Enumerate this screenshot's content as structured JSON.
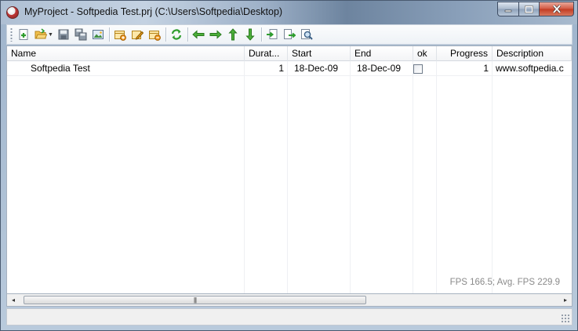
{
  "window": {
    "title": "MyProject - Softpedia Test.prj (C:\\Users\\Softpedia\\Desktop)",
    "minimize_icon": "minimize-icon",
    "maximize_icon": "maximize-icon",
    "close_icon": "close-icon"
  },
  "toolbar": {
    "buttons": [
      {
        "icon": "new-task-icon"
      },
      {
        "icon": "open-folder-icon"
      },
      {
        "icon": "save-icon"
      },
      {
        "icon": "save-all-icon"
      },
      {
        "icon": "image-export-icon"
      },
      {
        "icon": "add-item-icon"
      },
      {
        "icon": "edit-item-icon"
      },
      {
        "icon": "delete-item-icon"
      },
      {
        "icon": "refresh-icon"
      },
      {
        "icon": "arrow-left-icon"
      },
      {
        "icon": "arrow-right-icon"
      },
      {
        "icon": "arrow-up-icon"
      },
      {
        "icon": "arrow-down-icon"
      },
      {
        "icon": "import-icon"
      },
      {
        "icon": "export-icon"
      },
      {
        "icon": "search-icon"
      }
    ]
  },
  "grid": {
    "columns": [
      {
        "label": "Name"
      },
      {
        "label": "Durat..."
      },
      {
        "label": "Start"
      },
      {
        "label": "End"
      },
      {
        "label": "ok"
      },
      {
        "label": "Progress"
      },
      {
        "label": "Description"
      }
    ],
    "rows": [
      {
        "name": "Softpedia Test",
        "duration": "1",
        "start": "18-Dec-09",
        "end": "18-Dec-09",
        "ok": false,
        "progress": "1",
        "description": "www.softpedia.c"
      }
    ],
    "fps_text": "FPS 166.5; Avg. FPS 229.9"
  },
  "scrollbar": {
    "left_arrow": "◂",
    "right_arrow": "▸",
    "thumb_grip": "|||"
  },
  "colors": {
    "title_gradient_dark": "#6d849f",
    "toolbar_green": "#3aa03a",
    "toolbar_orange": "#f0a020"
  }
}
